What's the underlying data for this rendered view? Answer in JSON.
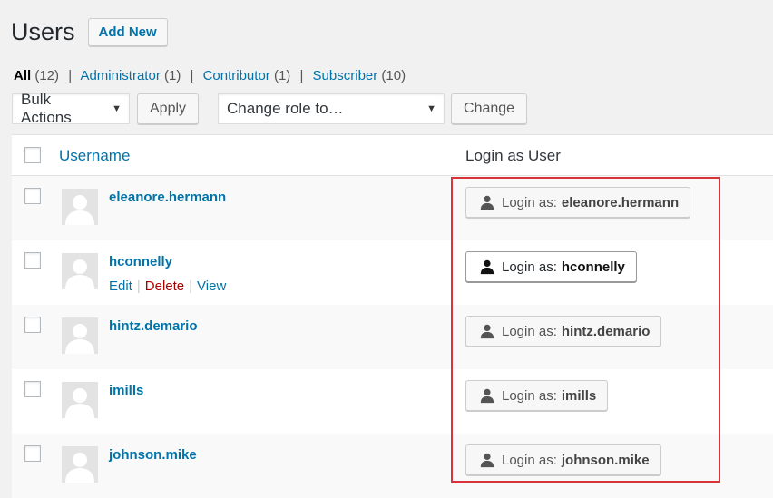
{
  "header": {
    "title": "Users",
    "add_new_label": "Add New"
  },
  "filters": {
    "all": {
      "label": "All",
      "count": "(12)"
    },
    "administrator": {
      "label": "Administrator",
      "count": "(1)"
    },
    "contributor": {
      "label": "Contributor",
      "count": "(1)"
    },
    "subscriber": {
      "label": "Subscriber",
      "count": "(10)"
    },
    "separator": "|"
  },
  "toolbar": {
    "bulk_actions": "Bulk Actions",
    "apply_label": "Apply",
    "change_role": "Change role to…",
    "change_label": "Change"
  },
  "table": {
    "col_username": "Username",
    "col_login": "Login as User",
    "login_prefix": "Login as:",
    "rows": [
      {
        "username": "eleanore.hermann"
      },
      {
        "username": "hconnelly",
        "actions": {
          "edit": "Edit",
          "delete": "Delete",
          "view": "View"
        }
      },
      {
        "username": "hintz.demario"
      },
      {
        "username": "imills"
      },
      {
        "username": "johnson.mike"
      }
    ]
  },
  "colors": {
    "link": "#0073aa",
    "delete": "#a00000",
    "highlight_border": "#d9343a"
  },
  "icons": {
    "user": "user-icon",
    "dropdown": "chevron-down-icon",
    "avatar": "default-avatar"
  }
}
